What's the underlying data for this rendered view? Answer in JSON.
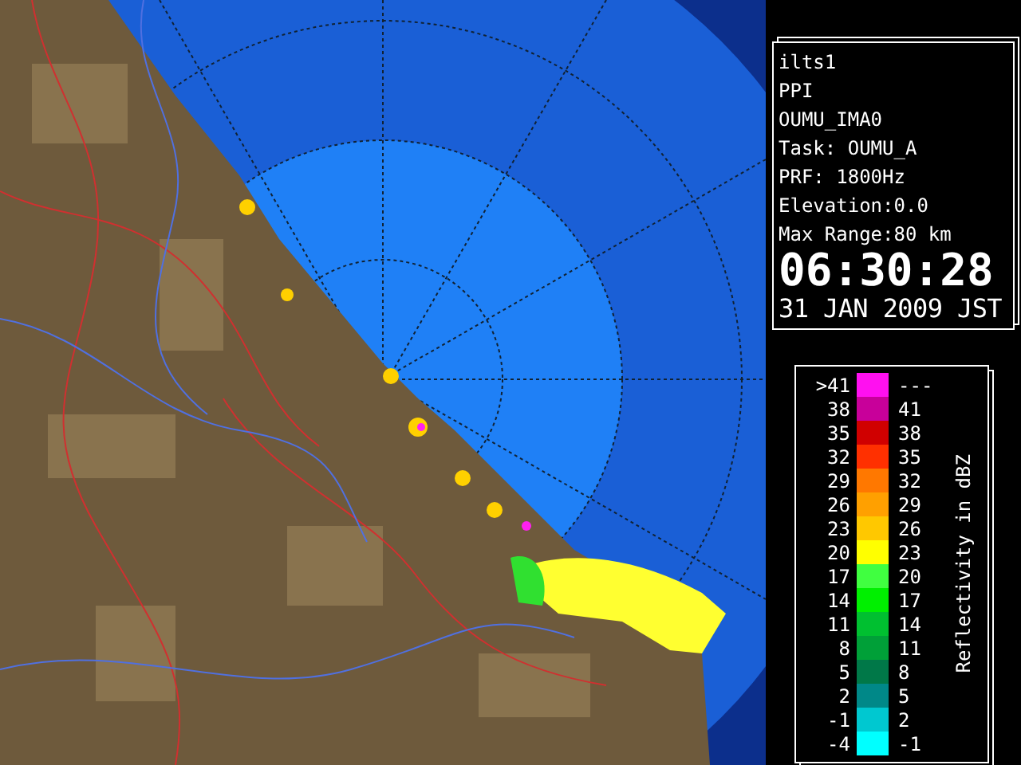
{
  "info": {
    "lines": [
      "ilts1",
      "PPI",
      "OUMU_IMA0",
      "Task: OUMU_A",
      "PRF: 1800Hz",
      "Elevation:0.0",
      "Max Range:80 km"
    ],
    "time": "06:30:28",
    "date": "31 JAN 2009 JST"
  },
  "legend": {
    "title": "Reflectivity in dBZ",
    "rows": [
      {
        "low": ">41",
        "high": "---",
        "color": "#ff10f0"
      },
      {
        "low": "38",
        "high": "41",
        "color": "#c8009a"
      },
      {
        "low": "35",
        "high": "38",
        "color": "#d00000"
      },
      {
        "low": "32",
        "high": "35",
        "color": "#ff3000"
      },
      {
        "low": "29",
        "high": "32",
        "color": "#ff7800"
      },
      {
        "low": "26",
        "high": "29",
        "color": "#ffa000"
      },
      {
        "low": "23",
        "high": "26",
        "color": "#ffc800"
      },
      {
        "low": "20",
        "high": "23",
        "color": "#ffff00"
      },
      {
        "low": "17",
        "high": "20",
        "color": "#40ff40"
      },
      {
        "low": "14",
        "high": "17",
        "color": "#00f000"
      },
      {
        "low": "11",
        "high": "14",
        "color": "#00c030"
      },
      {
        "low": "8",
        "high": "11",
        "color": "#00a038"
      },
      {
        "low": "5",
        "high": "8",
        "color": "#007848"
      },
      {
        "low": "2",
        "high": "5",
        "color": "#008888"
      },
      {
        "low": "-1",
        "high": "2",
        "color": "#00c8d0"
      },
      {
        "low": "-4",
        "high": "-1",
        "color": "#00ffff"
      }
    ]
  }
}
